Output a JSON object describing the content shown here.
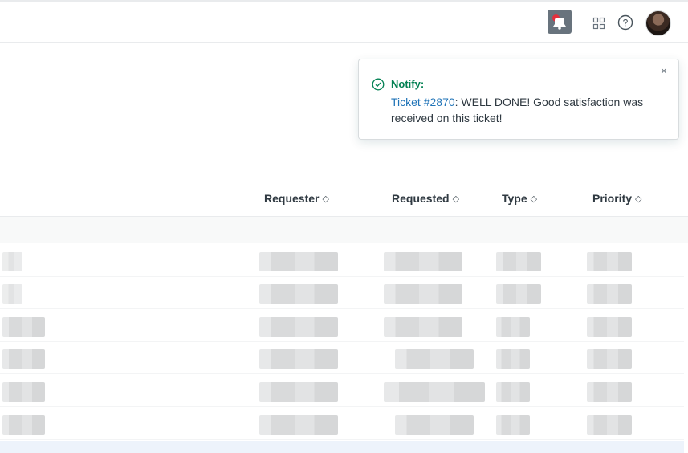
{
  "header": {
    "notification_icon": "bell-notification-icon",
    "apps_icon": "grid-icon",
    "help_icon": "help-circle-icon",
    "avatar_alt": "User avatar"
  },
  "toast": {
    "title": "Notify:",
    "link_text": "Ticket #2870",
    "message": ": WELL DONE! Good satisfaction was received on this ticket!",
    "close_label": "×",
    "status_color": "#038153",
    "link_color": "#1f73b7"
  },
  "table": {
    "columns": [
      {
        "label": "Requester"
      },
      {
        "label": "Requested"
      },
      {
        "label": "Type"
      },
      {
        "label": "Priority"
      }
    ],
    "sort_glyph": "◇",
    "row_count": 6
  }
}
